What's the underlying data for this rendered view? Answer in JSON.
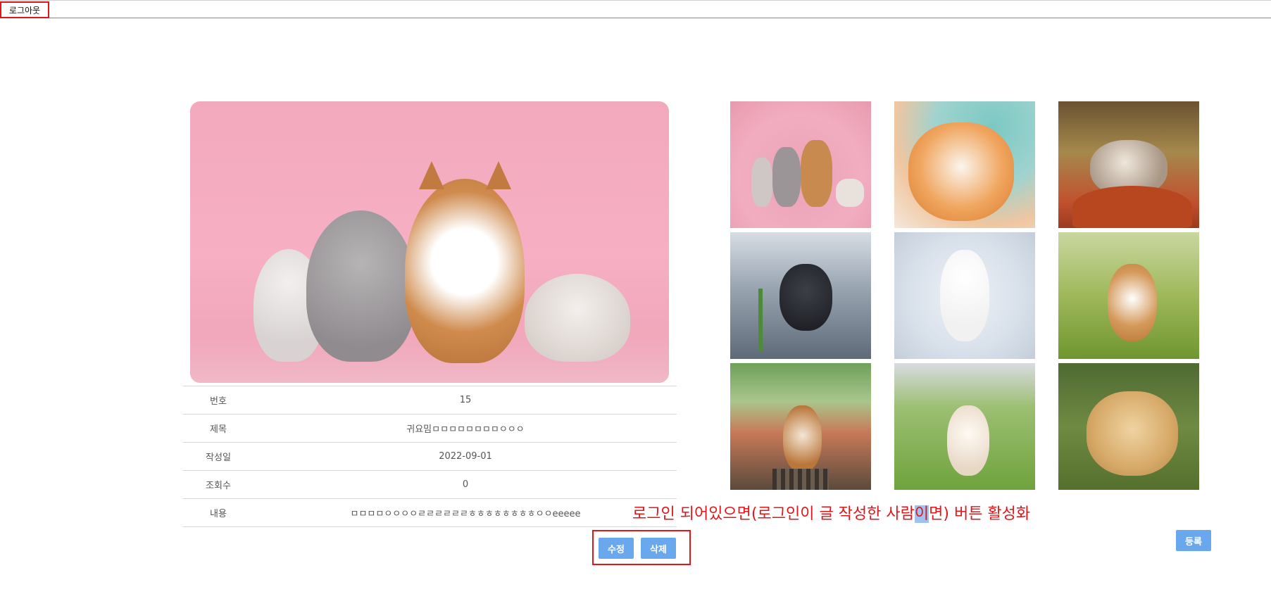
{
  "header": {
    "logout_label": "로그아웃"
  },
  "post": {
    "rows": [
      {
        "label": "번호",
        "value": "15"
      },
      {
        "label": "제목",
        "value": "귀요밈ㅁㅁㅁㅁㅁㅁㅁㅁㅇㅇㅇ"
      },
      {
        "label": "작성일",
        "value": "2022-09-01"
      },
      {
        "label": "조회수",
        "value": "0"
      },
      {
        "label": "내용",
        "value": "ㅁㅁㅁㅁㅇㅇㅇㅇㄹㄹㄹㄹㄹㄹㅎㅎㅎㅎㅎㅎㅎㅎㅇㅇeeeee"
      }
    ]
  },
  "actions": {
    "edit_label": "수정",
    "delete_label": "삭제",
    "register_label": "등록"
  },
  "annotation": {
    "part1": "로그인 되어있으면(로그인이 글 작성한 사람",
    "highlight": "이",
    "part2": "면) 버튼 활성화"
  },
  "gallery": {
    "items": [
      {
        "subject": "pets-on-pink"
      },
      {
        "subject": "orange-cat-licking"
      },
      {
        "subject": "kitten-in-pot"
      },
      {
        "subject": "kitten-on-cobblestone"
      },
      {
        "subject": "white-dog-in-snow"
      },
      {
        "subject": "corgi-in-grass"
      },
      {
        "subject": "dog-on-railway"
      },
      {
        "subject": "white-puppy-on-lawn"
      },
      {
        "subject": "golden-puppy-lying"
      }
    ]
  },
  "colors": {
    "accent": "#6aa8ee",
    "annotation_red": "#e0161b",
    "highlight": "#9fc2ee"
  }
}
